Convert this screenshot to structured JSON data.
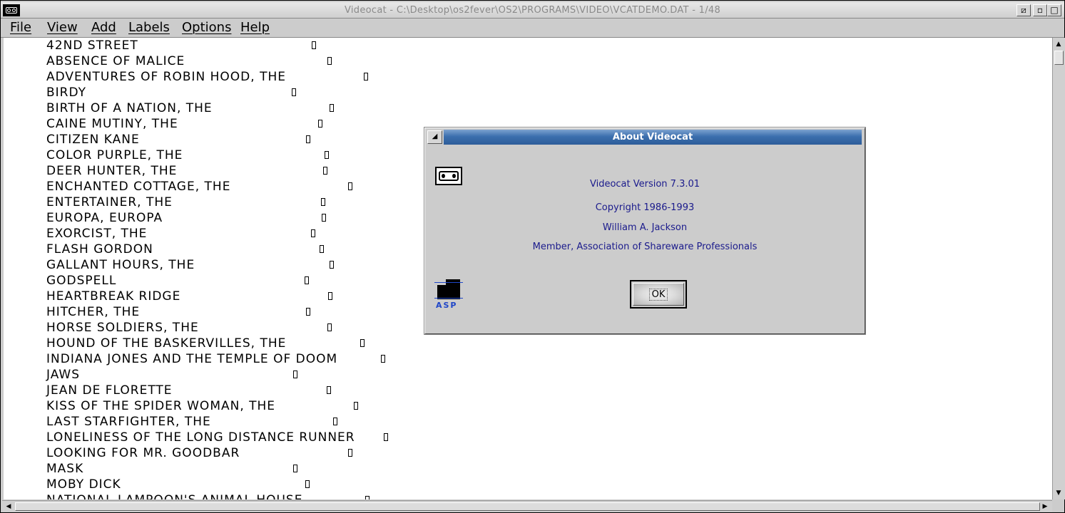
{
  "window": {
    "title": "Videocat - C:\\Desktop\\os2fever\\OS2\\PROGRAMS\\VIDEO\\VCATDEMO.DAT - 1/48",
    "buttons": {
      "hide": "⧄",
      "minimize": "▫",
      "maximize": "□"
    }
  },
  "menu": [
    "File",
    "View",
    "Add",
    "Labels",
    "Options",
    "Help"
  ],
  "movies": [
    {
      "title": "42ND STREET",
      "marker": 372
    },
    {
      "title": "ABSENCE OF MALICE",
      "marker": 394
    },
    {
      "title": "ADVENTURES OF ROBIN HOOD, THE",
      "marker": 445
    },
    {
      "title": "BIRDY",
      "marker": 344
    },
    {
      "title": "BIRTH OF A NATION, THE",
      "marker": 397
    },
    {
      "title": "CAINE MUTINY, THE",
      "marker": 381
    },
    {
      "title": "CITIZEN KANE",
      "marker": 364
    },
    {
      "title": "COLOR PURPLE, THE",
      "marker": 390
    },
    {
      "title": "DEER HUNTER, THE",
      "marker": 388
    },
    {
      "title": "ENCHANTED COTTAGE, THE",
      "marker": 423
    },
    {
      "title": "ENTERTAINER, THE",
      "marker": 385
    },
    {
      "title": "EUROPA, EUROPA",
      "marker": 386
    },
    {
      "title": "EXORCIST, THE",
      "marker": 371
    },
    {
      "title": "FLASH GORDON",
      "marker": 383
    },
    {
      "title": "GALLANT HOURS, THE",
      "marker": 397
    },
    {
      "title": "GODSPELL",
      "marker": 362
    },
    {
      "title": "HEARTBREAK RIDGE",
      "marker": 395
    },
    {
      "title": "HITCHER, THE",
      "marker": 364
    },
    {
      "title": "HORSE SOLDIERS, THE",
      "marker": 394
    },
    {
      "title": "HOUND OF THE BASKERVILLES, THE",
      "marker": 440
    },
    {
      "title": "INDIANA JONES AND THE TEMPLE OF DOOM",
      "marker": 469
    },
    {
      "title": "JAWS",
      "marker": 346
    },
    {
      "title": "JEAN DE FLORETTE",
      "marker": 393
    },
    {
      "title": "KISS OF THE SPIDER WOMAN, THE",
      "marker": 431
    },
    {
      "title": "LAST STARFIGHTER, THE",
      "marker": 402
    },
    {
      "title": "LONELINESS OF THE LONG DISTANCE RUNNER",
      "marker": 473
    },
    {
      "title": "LOOKING FOR MR. GOODBAR",
      "marker": 423
    },
    {
      "title": "MASK",
      "marker": 346
    },
    {
      "title": "MOBY DICK",
      "marker": 363
    },
    {
      "title": "NATIONAL LAMPOON'S ANIMAL HOUSE",
      "marker": 447
    }
  ],
  "about": {
    "title": "About Videocat",
    "version": "Videocat Version 7.3.01",
    "copyright": "Copyright 1986-1993",
    "author": "William A. Jackson",
    "member": "Member, Association of Shareware Professionals",
    "ok_label": "OK",
    "asp_letters": "ASP",
    "icons": [
      "vhs-tape-icon",
      "asp-logo-icon"
    ]
  }
}
